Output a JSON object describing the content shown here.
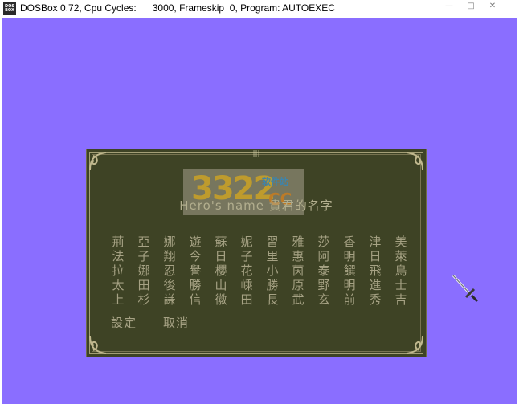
{
  "window": {
    "icon_label": "DOS BOX",
    "title": "DOSBox 0.72, Cpu Cycles:      3000, Frameskip  0, Program: AUTOEXEC"
  },
  "game": {
    "heading": "Hero's name 貴君的名字",
    "watermark": {
      "digits": "3322",
      "brand": "软件站",
      "tld": "CC"
    },
    "name_columns": [
      [
        "荊",
        "法",
        "拉",
        "太",
        "上"
      ],
      [
        "亞",
        "子",
        "娜",
        "田",
        "杉"
      ],
      [
        "娜",
        "翔",
        "忍",
        "後",
        "謙"
      ],
      [
        "遊",
        "今",
        "譽",
        "勝",
        "信"
      ],
      [
        "蘇",
        "日",
        "櫻",
        "山",
        "徽"
      ],
      [
        "妮",
        "子",
        "花",
        "嵊",
        "田"
      ],
      [
        "習",
        "里",
        "小",
        "勝",
        "長"
      ],
      [
        "雅",
        "惠",
        "茵",
        "原",
        "武"
      ],
      [
        "莎",
        "阿",
        "泰",
        "野",
        "玄"
      ],
      [
        "香",
        "明",
        "饌",
        "明",
        "前"
      ],
      [
        "津",
        "日",
        "飛",
        "進",
        "秀"
      ],
      [
        "美",
        "萊",
        "鳥",
        "士",
        "吉"
      ]
    ],
    "actions": {
      "confirm": "設定",
      "cancel": "取消"
    }
  },
  "colors": {
    "background": "#8a6eff",
    "panel": "#3e4325",
    "text": "#a6a284"
  }
}
